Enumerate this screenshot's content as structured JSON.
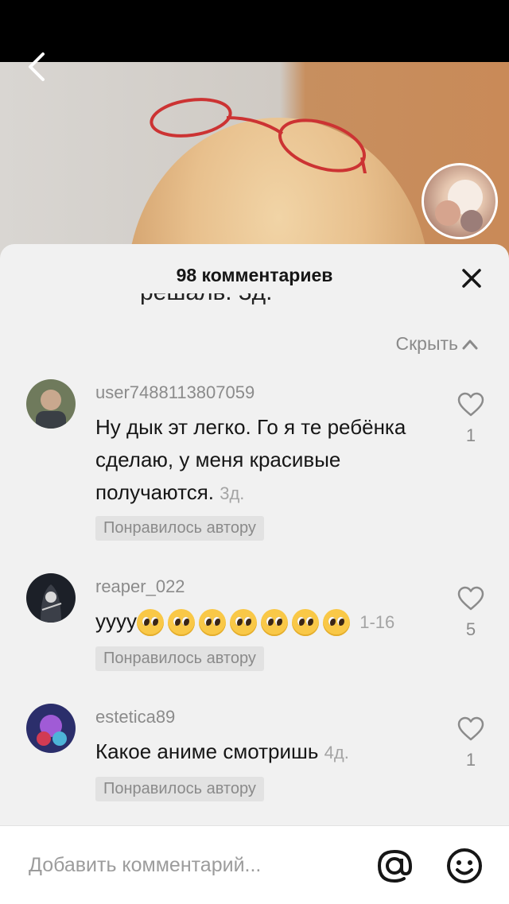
{
  "header": {
    "title": "98 комментариев"
  },
  "partial_text": "решаль. 3д.",
  "hide_label": "Скрыть",
  "comments": [
    {
      "username": "user7488113807059",
      "text": "Ну дык эт легко. Го я те ребёнка сделаю, у меня красивые получаются.",
      "time": "3д.",
      "badge": "Понравилось автору",
      "likes": "1"
    },
    {
      "username": "reaper_022",
      "text": "уууу",
      "emoji_count": 7,
      "time": "1-16",
      "badge": "Понравилось автору",
      "likes": "5"
    },
    {
      "username": "estetica89",
      "text": "Какое аниме смотришь",
      "time": "4д.",
      "badge": "Понравилось автору",
      "likes": "1"
    }
  ],
  "input": {
    "placeholder": "Добавить комментарий..."
  },
  "icons": {
    "back": "chevron-left-icon",
    "close": "close-icon",
    "hide": "chevron-up-icon",
    "like": "heart-icon",
    "mention": "at-icon",
    "emoji": "smiley-icon"
  },
  "colors": {
    "sheet_bg": "#f1f1f1",
    "muted_text": "#8b8b8b",
    "badge_bg": "#e2e2e2"
  }
}
